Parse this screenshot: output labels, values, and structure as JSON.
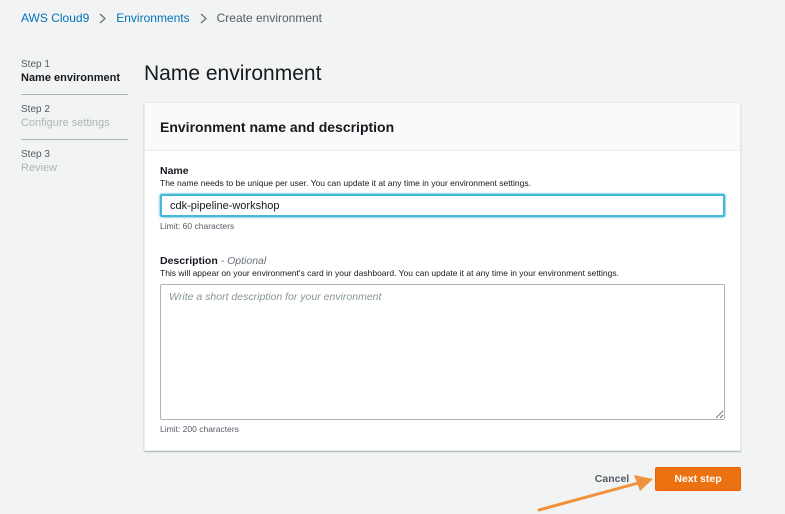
{
  "breadcrumb": {
    "items": [
      "AWS Cloud9",
      "Environments"
    ],
    "current": "Create environment"
  },
  "steps": [
    {
      "num": "Step 1",
      "label": "Name environment",
      "active": true
    },
    {
      "num": "Step 2",
      "label": "Configure settings",
      "active": false
    },
    {
      "num": "Step 3",
      "label": "Review",
      "active": false
    }
  ],
  "page_title": "Name environment",
  "panel": {
    "title": "Environment name and description",
    "name_field": {
      "label": "Name",
      "description": "The name needs to be unique per user. You can update it at any time in your environment settings.",
      "value": "cdk-pipeline-workshop",
      "hint": "Limit: 60 characters"
    },
    "description_field": {
      "label": "Description",
      "optional": "- Optional",
      "description": "This will appear on your environment's card in your dashboard. You can update it at any time in your environment settings.",
      "placeholder": "Write a short description for your environment",
      "hint": "Limit: 200 characters"
    }
  },
  "actions": {
    "cancel_label": "Cancel",
    "next_label": "Next step"
  },
  "colors": {
    "link": "#0073bb",
    "primary_button": "#ec7211",
    "focus_border": "#44b9d6",
    "annotation_arrow": "#f0923d"
  }
}
